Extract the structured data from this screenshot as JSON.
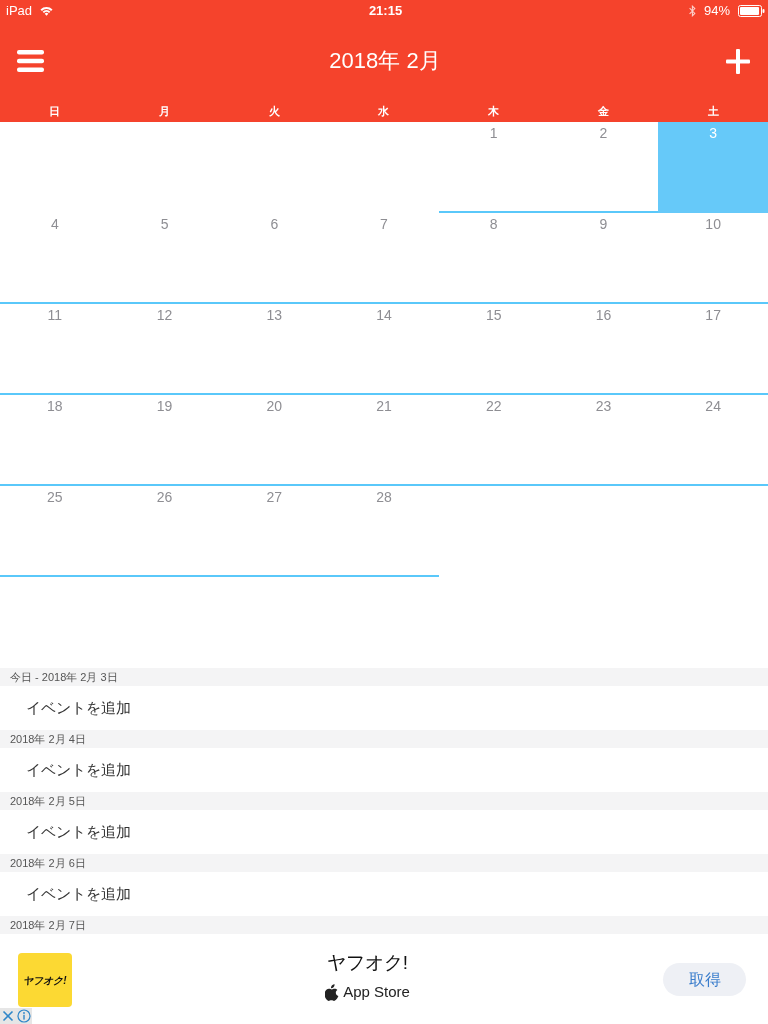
{
  "status_bar": {
    "device": "iPad",
    "time": "21:15",
    "battery": "94%"
  },
  "header": {
    "title": "2018年 2月"
  },
  "weekdays": [
    "日",
    "月",
    "火",
    "水",
    "木",
    "金",
    "土"
  ],
  "calendar": {
    "weeks": [
      [
        {
          "kind": "blank"
        },
        {
          "kind": "blank"
        },
        {
          "kind": "blank"
        },
        {
          "kind": "blank"
        },
        {
          "kind": "day",
          "day": "1",
          "selected": false
        },
        {
          "kind": "day",
          "day": "2",
          "selected": false
        },
        {
          "kind": "day",
          "day": "3",
          "selected": true
        }
      ],
      [
        {
          "kind": "day",
          "day": "4",
          "selected": false
        },
        {
          "kind": "day",
          "day": "5",
          "selected": false
        },
        {
          "kind": "day",
          "day": "6",
          "selected": false
        },
        {
          "kind": "day",
          "day": "7",
          "selected": false
        },
        {
          "kind": "day",
          "day": "8",
          "selected": false
        },
        {
          "kind": "day",
          "day": "9",
          "selected": false
        },
        {
          "kind": "day",
          "day": "10",
          "selected": false
        }
      ],
      [
        {
          "kind": "day",
          "day": "11",
          "selected": false
        },
        {
          "kind": "day",
          "day": "12",
          "selected": false
        },
        {
          "kind": "day",
          "day": "13",
          "selected": false
        },
        {
          "kind": "day",
          "day": "14",
          "selected": false
        },
        {
          "kind": "day",
          "day": "15",
          "selected": false
        },
        {
          "kind": "day",
          "day": "16",
          "selected": false
        },
        {
          "kind": "day",
          "day": "17",
          "selected": false
        }
      ],
      [
        {
          "kind": "day",
          "day": "18",
          "selected": false
        },
        {
          "kind": "day",
          "day": "19",
          "selected": false
        },
        {
          "kind": "day",
          "day": "20",
          "selected": false
        },
        {
          "kind": "day",
          "day": "21",
          "selected": false
        },
        {
          "kind": "day",
          "day": "22",
          "selected": false
        },
        {
          "kind": "day",
          "day": "23",
          "selected": false
        },
        {
          "kind": "day",
          "day": "24",
          "selected": false
        }
      ],
      [
        {
          "kind": "day",
          "day": "25",
          "selected": false
        },
        {
          "kind": "day",
          "day": "26",
          "selected": false
        },
        {
          "kind": "day",
          "day": "27",
          "selected": false
        },
        {
          "kind": "day",
          "day": "28",
          "selected": false
        }
      ]
    ]
  },
  "agenda": [
    {
      "heading": "今日 - 2018年 2月 3日",
      "entry": "イベントを追加"
    },
    {
      "heading": "2018年 2月 4日",
      "entry": "イベントを追加"
    },
    {
      "heading": "2018年 2月 5日",
      "entry": "イベントを追加"
    },
    {
      "heading": "2018年 2月 6日",
      "entry": "イベントを追加"
    },
    {
      "heading": "2018年 2月 7日"
    }
  ],
  "ad": {
    "logo_text": "ヤフオク!",
    "app_name": "ヤフオク!",
    "store": "App Store",
    "button": "取得"
  }
}
